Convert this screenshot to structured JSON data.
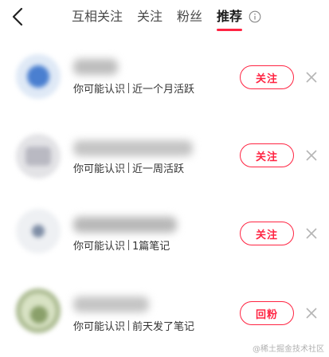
{
  "header": {
    "back_icon": "chevron-left-icon",
    "tabs": [
      {
        "label": "互相关注",
        "active": false
      },
      {
        "label": "关注",
        "active": false
      },
      {
        "label": "粉丝",
        "active": false
      },
      {
        "label": "推荐",
        "active": true
      }
    ],
    "info_icon": "info-icon",
    "accent_color": "#ff2442"
  },
  "suggestions": [
    {
      "reason": "你可能认识",
      "activity": "近一个月活跃",
      "action_label": "关注"
    },
    {
      "reason": "你可能认识",
      "activity": "近一周活跃",
      "action_label": "关注"
    },
    {
      "reason": "你可能认识",
      "activity": "1篇笔记",
      "action_label": "关注"
    },
    {
      "reason": "你可能认识",
      "activity": "前天发了笔记",
      "action_label": "回粉"
    }
  ],
  "watermark": "@稀土掘金技术社区"
}
